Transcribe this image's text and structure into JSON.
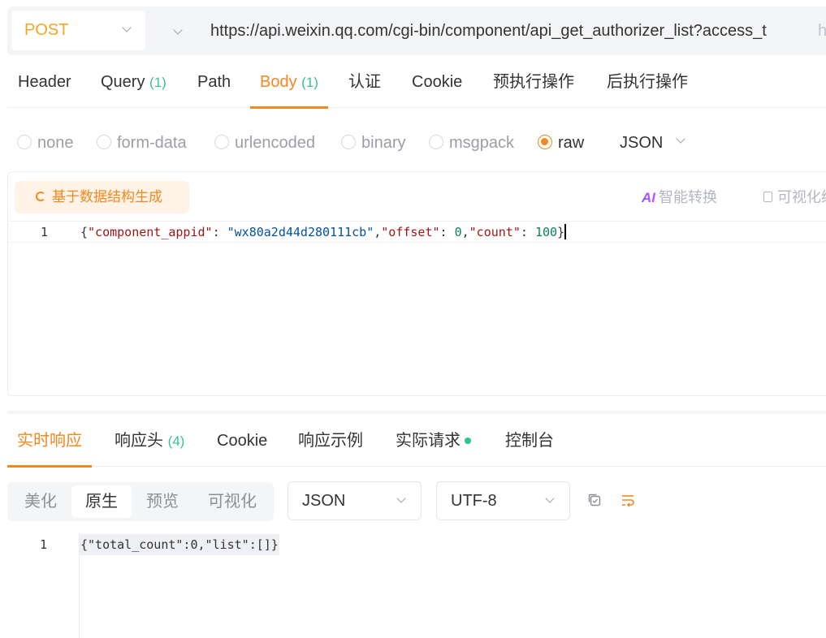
{
  "request": {
    "method": "POST",
    "url": "https://api.weixin.qq.com/cgi-bin/component/api_get_authorizer_list?access_t",
    "url_overflow": "h"
  },
  "tabs": [
    {
      "label": "Header",
      "count": ""
    },
    {
      "label": "Query",
      "count": "(1)"
    },
    {
      "label": "Path",
      "count": ""
    },
    {
      "label": "Body",
      "count": "(1)"
    },
    {
      "label": "认证",
      "count": ""
    },
    {
      "label": "Cookie",
      "count": ""
    },
    {
      "label": "预执行操作",
      "count": ""
    },
    {
      "label": "后执行操作",
      "count": ""
    }
  ],
  "active_tab": "Body",
  "body_types": [
    "none",
    "form-data",
    "urlencoded",
    "binary",
    "msgpack",
    "raw"
  ],
  "selected_body_type": "raw",
  "body_format": "JSON",
  "editor": {
    "generate_button": "基于数据结构生成",
    "ai_button": "智能转换",
    "ai_icon_text": "AI",
    "visual_button": "可视化编",
    "line_number": "1",
    "tokens": {
      "key1": "\"component_appid\"",
      "val1": "\"wx80a2d44d280111cb\"",
      "key2": "\"offset\"",
      "val2": "0",
      "key3": "\"count\"",
      "val3": "100"
    }
  },
  "response": {
    "tabs": [
      {
        "label": "实时响应",
        "count": ""
      },
      {
        "label": "响应头",
        "count": "(4)"
      },
      {
        "label": "Cookie",
        "count": ""
      },
      {
        "label": "响应示例",
        "count": ""
      },
      {
        "label": "实际请求",
        "count": ""
      },
      {
        "label": "控制台",
        "count": ""
      }
    ],
    "active_tab": "实时响应",
    "view_modes": [
      "美化",
      "原生",
      "预览",
      "可视化"
    ],
    "active_view_mode": "原生",
    "format": "JSON",
    "encoding": "UTF-8",
    "line_number": "1",
    "body": "{\"total_count\":0,\"list\":[]}"
  },
  "colors": {
    "accent": "#f5871f",
    "method_post": "#f5a623",
    "count_green": "#3ec08f",
    "status_dot": "#2dc58a"
  }
}
